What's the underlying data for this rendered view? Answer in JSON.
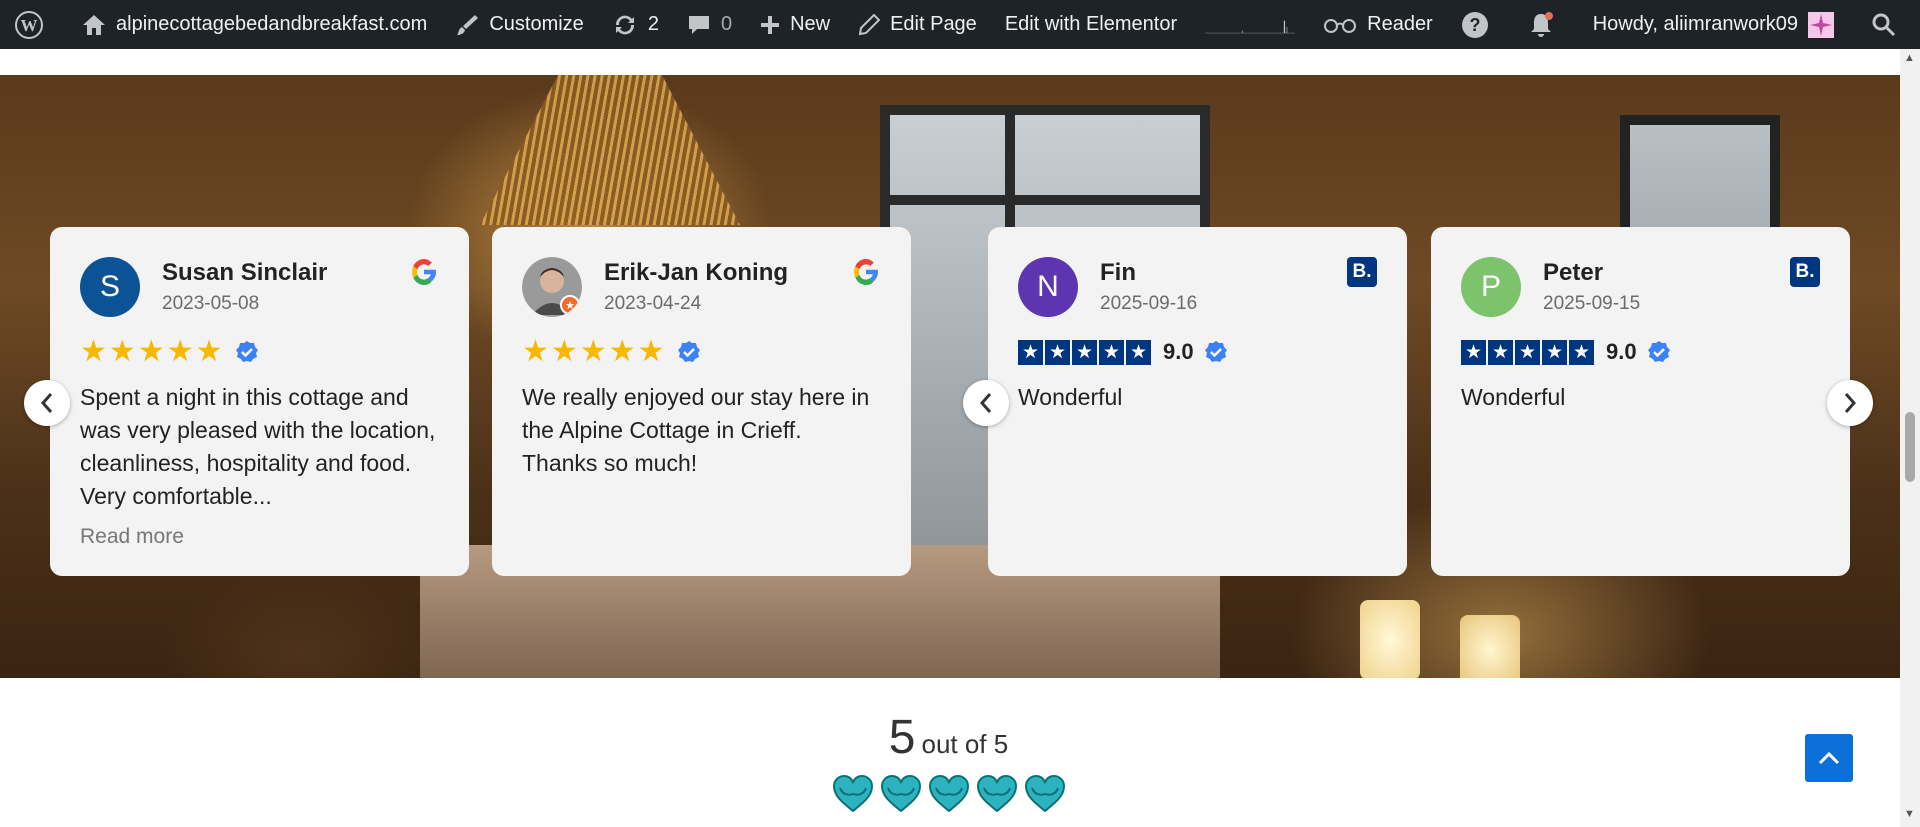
{
  "adminbar": {
    "site_name": "alpinecottagebedandbreakfast.com",
    "customize": "Customize",
    "updates_count": "2",
    "comments_count": "0",
    "new_label": "New",
    "edit_page": "Edit Page",
    "edit_elementor": "Edit with Elementor",
    "reader": "Reader",
    "howdy": "Howdy, aliimranwork09"
  },
  "reviews": [
    {
      "initial": "S",
      "avatar_color": "#0b5394",
      "name": "Susan Sinclair",
      "date": "2023-05-08",
      "source": "google",
      "text": "Spent a night in this cottage and was very pleased with the location, cleanliness, hospitality and food. Very comfortable...",
      "read_more": "Read more"
    },
    {
      "initial": "",
      "avatar_color": "#777777",
      "name": "Erik-Jan Koning",
      "date": "2023-04-24",
      "source": "google",
      "text": "We really enjoyed our stay here in the Alpine Cottage in Crieff. Thanks so much!"
    },
    {
      "initial": "N",
      "avatar_color": "#5e35b1",
      "name": "Fin",
      "date": "2025-09-16",
      "source": "booking",
      "score": "9.0",
      "text": "Wonderful"
    },
    {
      "initial": "P",
      "avatar_color": "#7cc36b",
      "name": "Peter",
      "date": "2025-09-15",
      "source": "booking",
      "score": "9.0",
      "text": "Wonderful"
    }
  ],
  "summary": {
    "score": "5",
    "out_of": "out of 5",
    "hearts": 5,
    "heart_color": "#2bb3c0"
  },
  "colors": {
    "adminbar": "#1d2327",
    "booking": "#003580",
    "star": "#f7b801",
    "totop": "#0a6fd8"
  }
}
